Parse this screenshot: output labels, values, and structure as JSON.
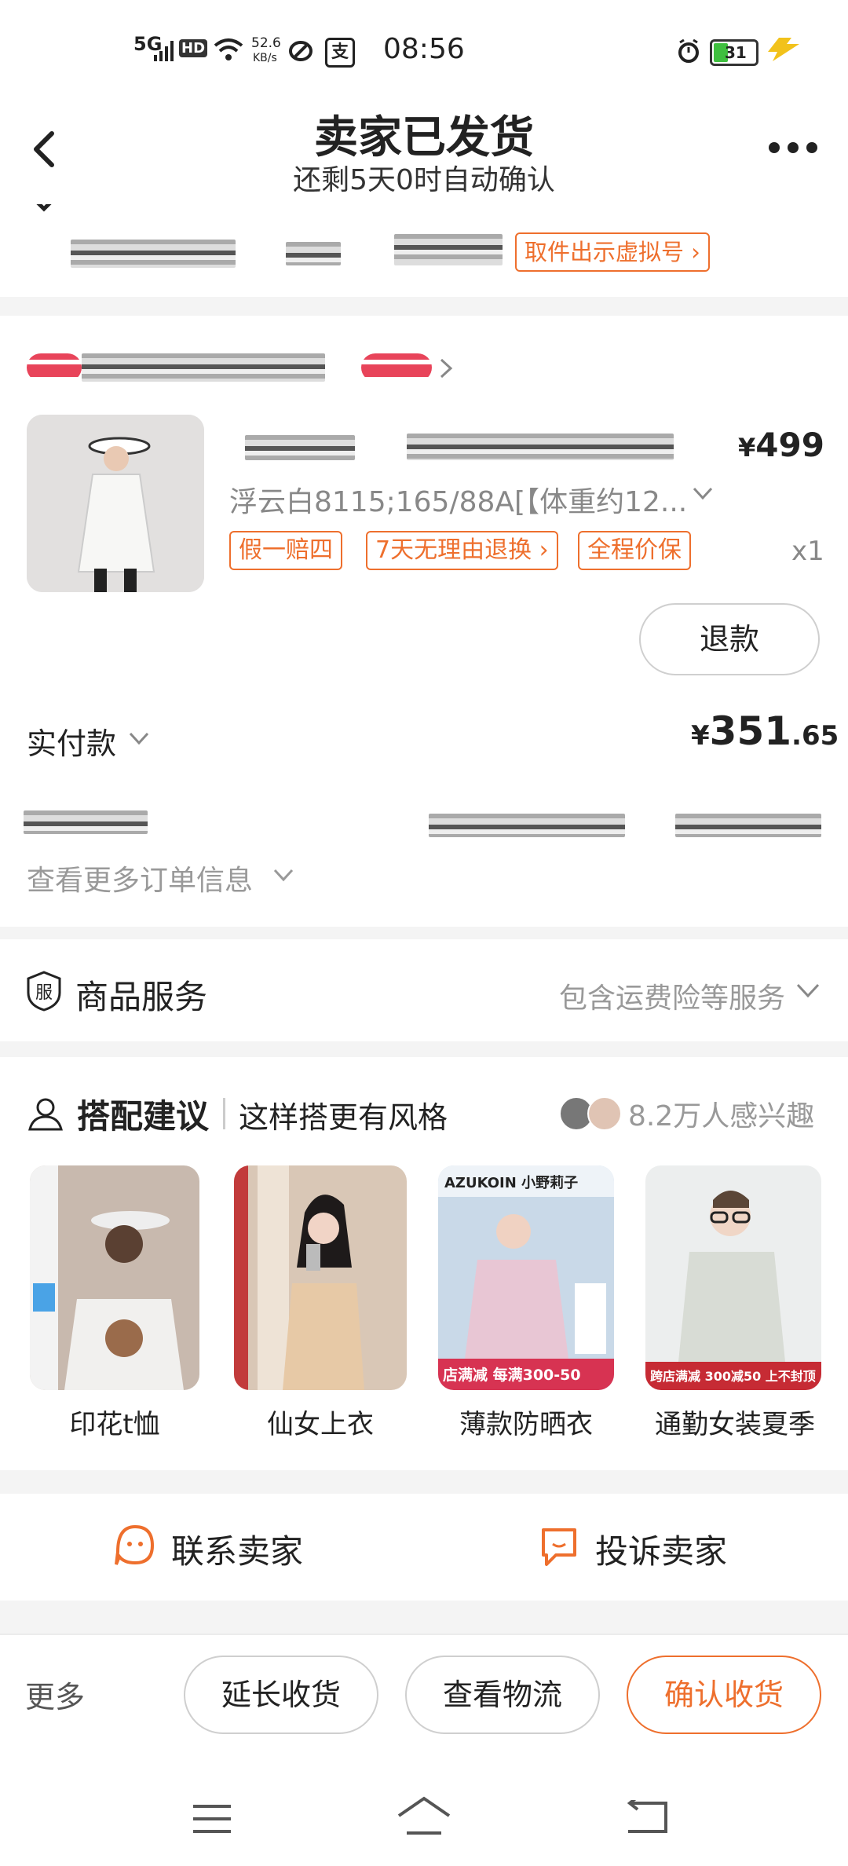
{
  "status_bar": {
    "network": "5G",
    "hd": "HD",
    "speed_value": "52.6",
    "speed_unit": "KB/s",
    "time": "08:56",
    "battery": "31"
  },
  "header": {
    "title": "卖家已发货",
    "subtitle": "还剩5天0时自动确认"
  },
  "shipping": {
    "pickup_label": "取件出示虚拟号"
  },
  "product": {
    "price": "499",
    "currency": "¥",
    "variant": "浮云白8115;165/88A[【体重约12...",
    "tags": [
      "假一赔四",
      "7天无理由退换",
      "全程价保"
    ],
    "quantity": "x1",
    "refund_label": "退款"
  },
  "payment": {
    "label": "实付款",
    "currency": "¥",
    "amount_int": "351",
    "amount_dec": ".65"
  },
  "more_info_label": "查看更多订单信息",
  "service": {
    "icon_char": "服",
    "label": "商品服务",
    "detail": "包含运费险等服务"
  },
  "recommend": {
    "title": "搭配建议",
    "subtitle": "这样搭更有风格",
    "interest": "8.2万人感兴趣",
    "items": [
      {
        "label": "印花t恤",
        "color": "#c8b9ae"
      },
      {
        "label": "仙女上衣",
        "color": "#d9c7b6"
      },
      {
        "label": "薄款防晒衣",
        "color": "#e7d2dd"
      },
      {
        "label": "通勤女装夏季",
        "color": "#d8dcd5"
      }
    ],
    "item3_banner": "AZUKOIN 小野莉子",
    "item3_promo": "店满减 每满300-50",
    "item4_promo": "跨店满减 300减50 上不封顶"
  },
  "contact": {
    "seller": "联系卖家",
    "complain": "投诉卖家"
  },
  "bottom_bar": {
    "more": "更多",
    "extend": "延长收货",
    "logistics": "查看物流",
    "confirm": "确认收货"
  },
  "colors": {
    "accent": "#ee6f2d",
    "brand_red": "#e8445a"
  }
}
